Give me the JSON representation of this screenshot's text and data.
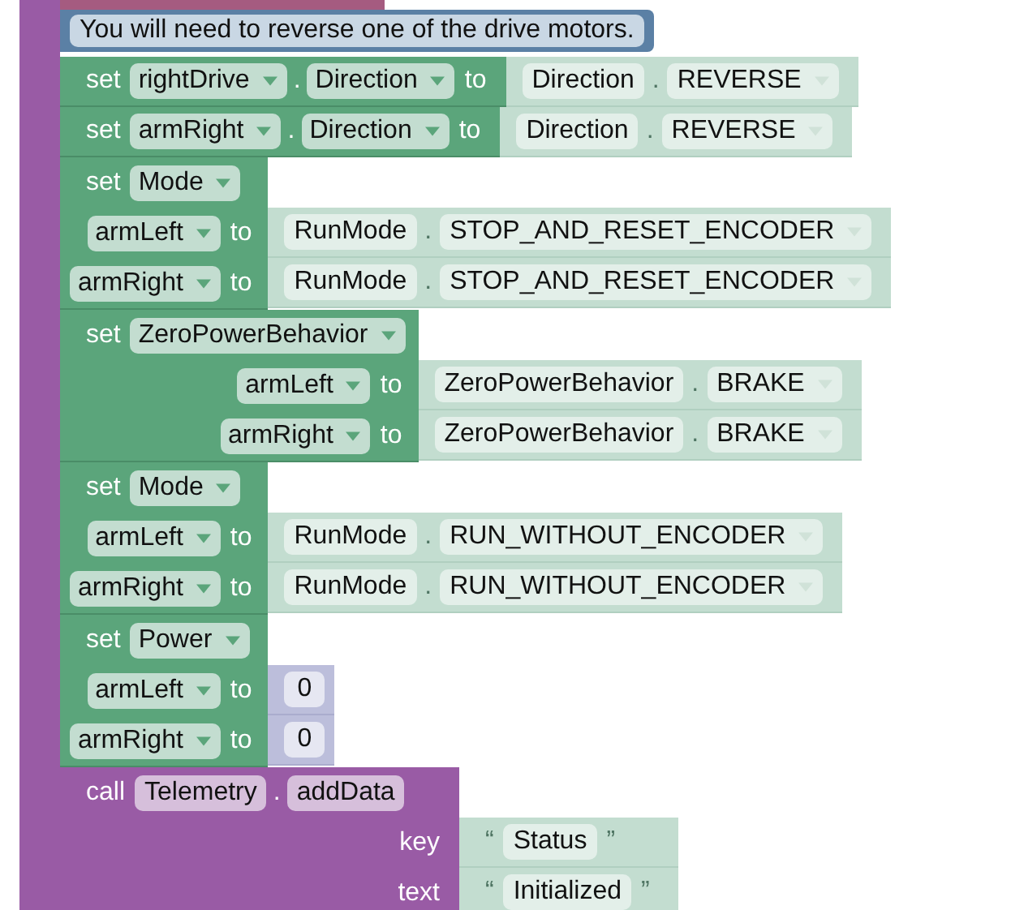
{
  "blocks": [
    {
      "kind": "comment",
      "text": "You will need to reverse one of the drive motors."
    },
    {
      "kind": "set_single",
      "keyword": "set",
      "device": "rightDrive",
      "dot": ".",
      "property": "Direction",
      "to": "to",
      "value": {
        "kind": "enum",
        "class": "Direction",
        "dot": ".",
        "member": "REVERSE"
      }
    },
    {
      "kind": "set_single",
      "keyword": "set",
      "device": "armRight",
      "dot": ".",
      "property": "Direction",
      "to": "to",
      "value": {
        "kind": "enum",
        "class": "Direction",
        "dot": ".",
        "member": "REVERSE"
      }
    },
    {
      "kind": "set_multi",
      "keyword": "set",
      "property": "Mode",
      "rows": [
        {
          "device": "armLeft",
          "to": "to",
          "value": {
            "kind": "enum",
            "class": "RunMode",
            "dot": ".",
            "member": "STOP_AND_RESET_ENCODER"
          }
        },
        {
          "device": "armRight",
          "to": "to",
          "value": {
            "kind": "enum",
            "class": "RunMode",
            "dot": ".",
            "member": "STOP_AND_RESET_ENCODER"
          }
        }
      ]
    },
    {
      "kind": "set_multi",
      "keyword": "set",
      "property": "ZeroPowerBehavior",
      "rows": [
        {
          "device": "armLeft",
          "to": "to",
          "value": {
            "kind": "enum",
            "class": "ZeroPowerBehavior",
            "dot": ".",
            "member": "BRAKE"
          }
        },
        {
          "device": "armRight",
          "to": "to",
          "value": {
            "kind": "enum",
            "class": "ZeroPowerBehavior",
            "dot": ".",
            "member": "BRAKE"
          }
        }
      ]
    },
    {
      "kind": "set_multi",
      "keyword": "set",
      "property": "Mode",
      "rows": [
        {
          "device": "armLeft",
          "to": "to",
          "value": {
            "kind": "enum",
            "class": "RunMode",
            "dot": ".",
            "member": "RUN_WITHOUT_ENCODER"
          }
        },
        {
          "device": "armRight",
          "to": "to",
          "value": {
            "kind": "enum",
            "class": "RunMode",
            "dot": ".",
            "member": "RUN_WITHOUT_ENCODER"
          }
        }
      ]
    },
    {
      "kind": "set_multi",
      "keyword": "set",
      "property": "Power",
      "rows": [
        {
          "device": "armLeft",
          "to": "to",
          "value": {
            "kind": "number",
            "text": "0"
          }
        },
        {
          "device": "armRight",
          "to": "to",
          "value": {
            "kind": "number",
            "text": "0"
          }
        }
      ]
    },
    {
      "kind": "call",
      "keyword": "call",
      "class": "Telemetry",
      "dot": ".",
      "method": "addData",
      "args": [
        {
          "label": "key",
          "value": {
            "kind": "text",
            "open": "“",
            "text": "Status",
            "close": "”"
          }
        },
        {
          "label": "text",
          "value": {
            "kind": "text",
            "open": "“",
            "text": "Initialized",
            "close": "”"
          }
        }
      ]
    }
  ]
}
